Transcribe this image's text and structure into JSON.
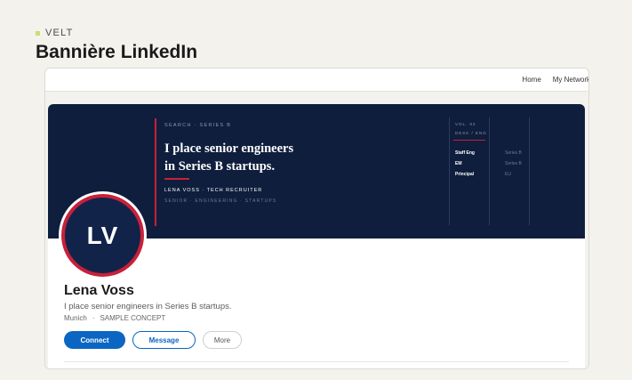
{
  "brand": {
    "name": "VELT",
    "accent": "#c6e36a"
  },
  "page": {
    "title": "Bannière LinkedIn"
  },
  "nav": {
    "items": [
      "Home",
      "My Network"
    ]
  },
  "banner": {
    "eyebrow": "SEARCH  ·  SERIES B",
    "headline_line1": "I place senior engineers",
    "headline_line2": "in Series B startups.",
    "byline": "LENA VOSS  ·  TECH RECRUITER",
    "tags": "SENIOR  ·  ENGINEERING  ·  STARTUPS",
    "vol_line1": "VOL. 02",
    "vol_line2": "DESK / ENG",
    "table": [
      {
        "key": "Staff Eng",
        "value": "Series B"
      },
      {
        "key": "EM",
        "value": "Series B"
      },
      {
        "key": "Principal",
        "value": "EU"
      }
    ],
    "colors": {
      "background": "#0f1e3d",
      "accent": "#c8203a"
    }
  },
  "profile": {
    "initials": "LV",
    "name": "Lena Voss",
    "tagline": "I place senior engineers in Series B startups.",
    "location": "Munich",
    "note": "SAMPLE CONCEPT"
  },
  "actions": {
    "connect": "Connect",
    "message": "Message",
    "more": "More",
    "primary_color": "#0a66c2"
  }
}
